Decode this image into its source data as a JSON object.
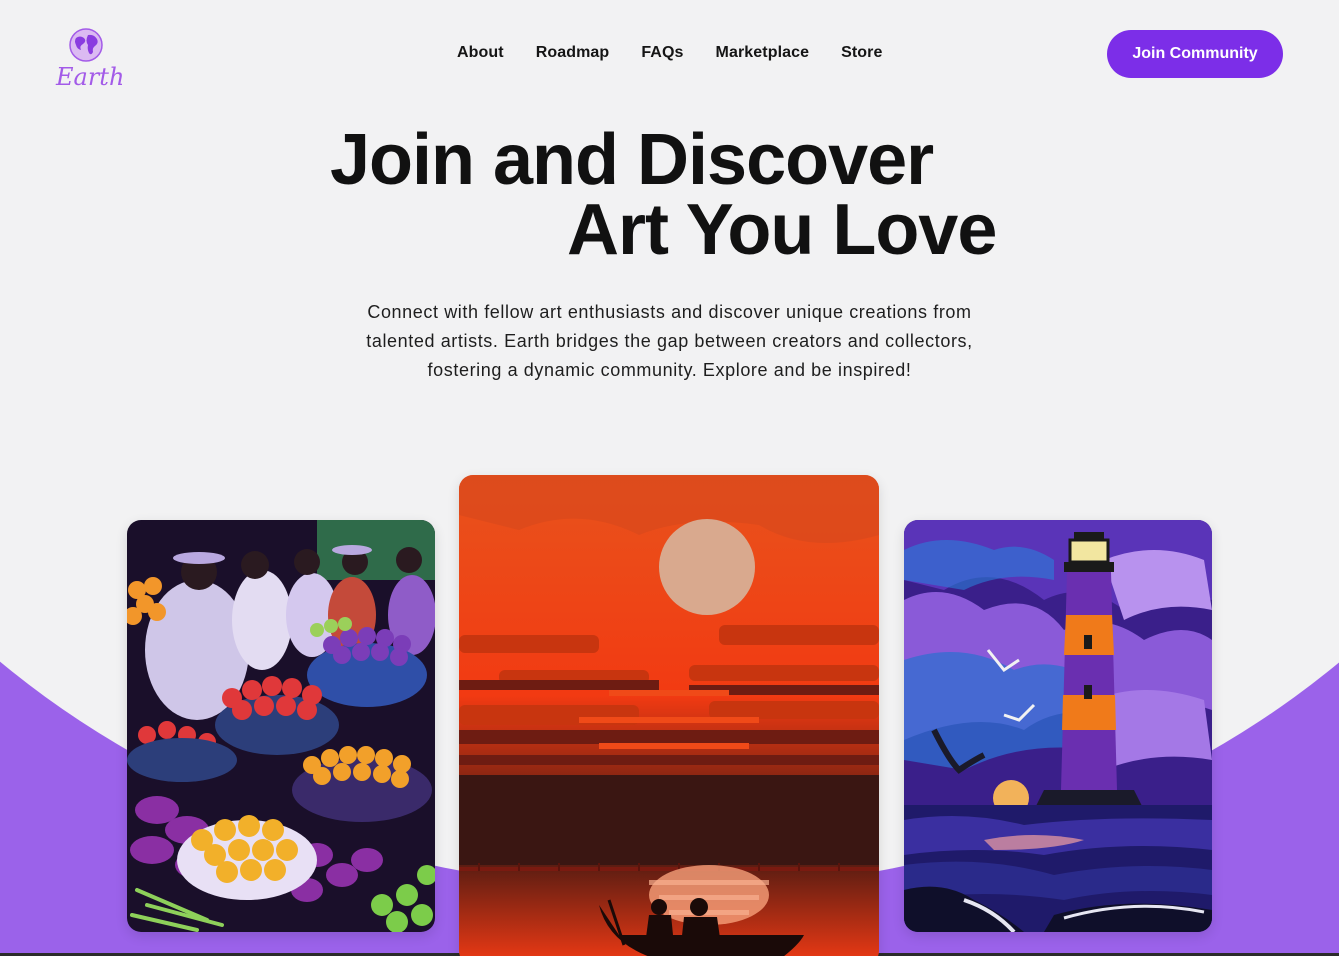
{
  "brand": {
    "logo_text": "Earth",
    "icon": "globe-icon",
    "color": "#a35be8"
  },
  "nav": {
    "items": [
      {
        "label": "About"
      },
      {
        "label": "Roadmap"
      },
      {
        "label": "FAQs"
      },
      {
        "label": "Marketplace"
      },
      {
        "label": "Store"
      }
    ]
  },
  "cta": {
    "label": "Join Community",
    "color": "#7c2ee8"
  },
  "hero": {
    "title_line1": "Join and Discover",
    "title_line2": "Art You Love",
    "subtitle_line1": "Connect with fellow art enthusiasts and discover unique creations from",
    "subtitle_line2": "talented artists. Earth bridges the gap between creators and collectors,",
    "subtitle_line3": "fostering a dynamic community. Explore and be inspired!"
  },
  "gallery": {
    "background_color": "#9b62ea",
    "cards": [
      {
        "subject": "fruit-market-painting"
      },
      {
        "subject": "sunset-boat-painting"
      },
      {
        "subject": "lighthouse-painting"
      }
    ]
  }
}
